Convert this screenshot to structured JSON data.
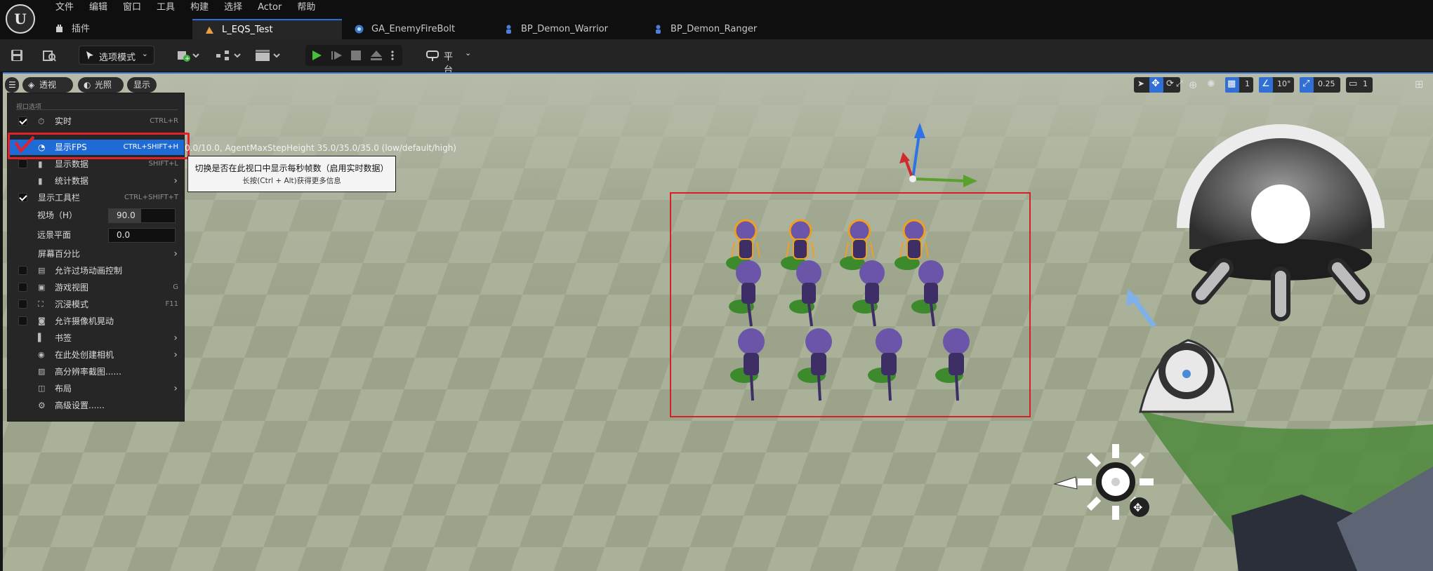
{
  "app": {
    "logo_text": "U"
  },
  "menu": [
    "文件",
    "编辑",
    "窗口",
    "工具",
    "构建",
    "选择",
    "Actor",
    "帮助"
  ],
  "tabs": [
    {
      "label": "插件",
      "icon": "plugin-icon",
      "active": false
    },
    {
      "label": "L_EQS_Test",
      "icon": "level-icon",
      "active": true
    },
    {
      "label": "GA_EnemyFireBolt",
      "icon": "blueprint-icon",
      "active": false
    },
    {
      "label": "BP_Demon_Warrior",
      "icon": "character-blueprint-icon",
      "active": false
    },
    {
      "label": "BP_Demon_Ranger",
      "icon": "character-blueprint-icon",
      "active": false
    }
  ],
  "toolbar": {
    "mode_label": "选项模式",
    "platform_label": "平台"
  },
  "viewport": {
    "chips": [
      "透视",
      "光照",
      "显示"
    ],
    "stat_text": "0.0/10.0, AgentMaxStepHeight 35.0/35.0/35.0 (low/default/high)",
    "right_tools": {
      "grid_snap": "1",
      "rotation_snap": "10°",
      "scale_snap": "0.25",
      "camera_speed": "1"
    }
  },
  "options_menu": {
    "header": "视口选项",
    "items": [
      {
        "label": "实时",
        "shortcut": "CTRL+R",
        "checked": true
      },
      {
        "label": "显示FPS",
        "shortcut": "CTRL+SHIFT+H",
        "checked": true,
        "selected": true
      },
      {
        "label": "显示数据",
        "shortcut": "SHIFT+L",
        "checked": false
      },
      {
        "label": "统计数据",
        "submenu": true
      },
      {
        "label": "显示工具栏",
        "shortcut": "CTRL+SHIFT+T",
        "checked": true
      },
      {
        "label": "视场（H）",
        "value": "90.0"
      },
      {
        "label": "远景平面",
        "value": "0.0"
      },
      {
        "label": "屏幕百分比",
        "submenu": true
      },
      {
        "label": "允许过场动画控制",
        "checked": false
      },
      {
        "label": "游戏视图",
        "shortcut": "G",
        "checked": false
      },
      {
        "label": "沉浸模式",
        "shortcut": "F11",
        "checked": false
      },
      {
        "label": "允许摄像机晃动",
        "checked": false
      },
      {
        "label": "书签",
        "submenu": true
      },
      {
        "label": "在此处创建相机",
        "submenu": true
      },
      {
        "label": "高分辨率截图......"
      },
      {
        "label": "布局",
        "submenu": true
      },
      {
        "label": "高级设置......"
      }
    ]
  },
  "tooltip": {
    "line1": "切换是否在此视口中显示每秒帧数（启用实时数据）",
    "line2": "长按(Ctrl + Alt)获得更多信息"
  },
  "colors": {
    "accent": "#1f6bd6",
    "highlight": "#e3202b",
    "ground_light": "#a5ad95",
    "ground_dark": "#949c84",
    "character": "#6e55a6",
    "selection_outline": "#f0a020"
  }
}
